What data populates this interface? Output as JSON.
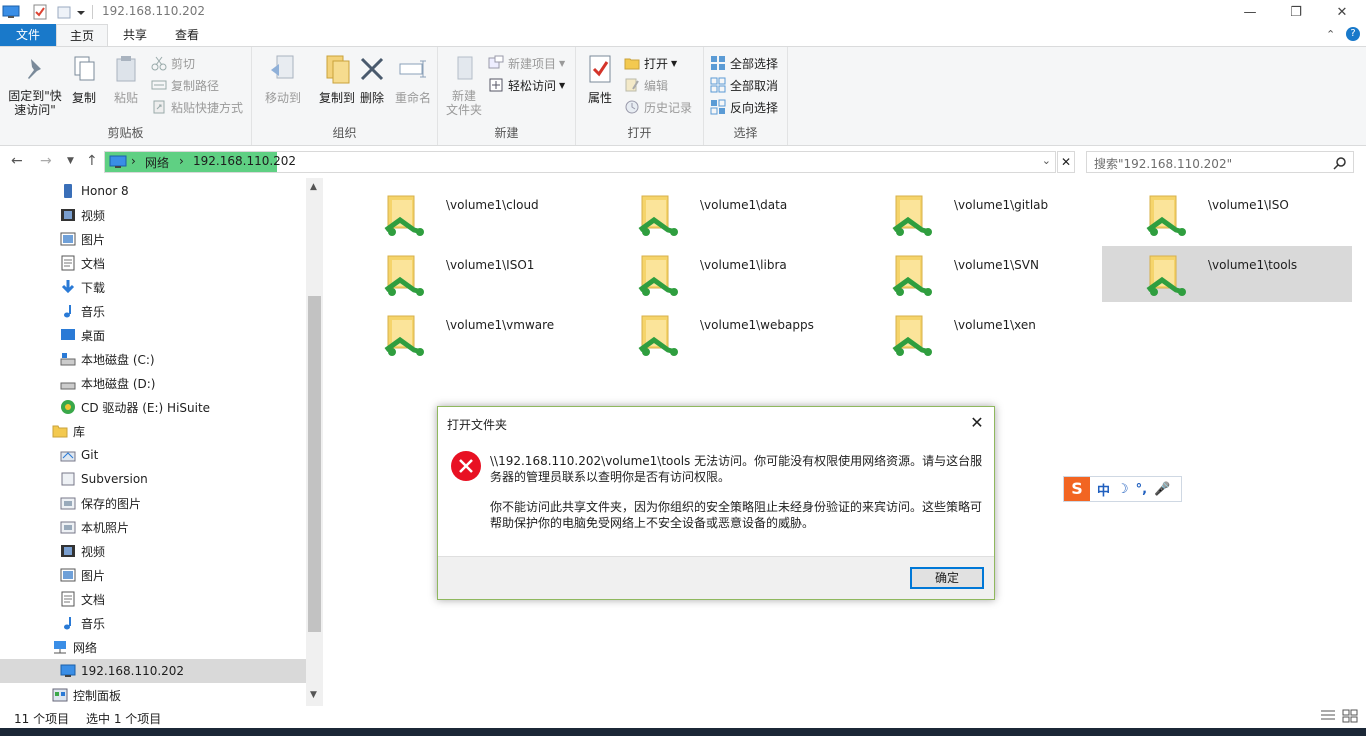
{
  "window": {
    "title": "192.168.110.202"
  },
  "ribbon_tabs": [
    "文件",
    "主页",
    "共享",
    "查看"
  ],
  "ribbon": {
    "clipboard": {
      "label": "剪贴板",
      "pin": "固定到\"快速访问\"",
      "copy": "复制",
      "paste": "粘贴",
      "cut": "剪切",
      "copy_path": "复制路径",
      "paste_shortcut": "粘贴快捷方式"
    },
    "organize": {
      "label": "组织",
      "move_to": "移动到",
      "copy_to": "复制到",
      "delete": "删除",
      "rename": "重命名"
    },
    "new": {
      "label": "新建",
      "new_folder": "新建\n文件夹",
      "new_item": "新建项目",
      "easy_access": "轻松访问"
    },
    "open": {
      "label": "打开",
      "properties": "属性",
      "open": "打开",
      "edit": "编辑",
      "history": "历史记录"
    },
    "select": {
      "label": "选择",
      "select_all": "全部选择",
      "select_none": "全部取消",
      "invert": "反向选择"
    }
  },
  "address": {
    "crumbs": [
      "网络",
      "192.168.110.202"
    ]
  },
  "search": {
    "placeholder": "搜索\"192.168.110.202\""
  },
  "sidebar": {
    "items": [
      "Honor 8",
      "视频",
      "图片",
      "文档",
      "下载",
      "音乐",
      "桌面",
      "本地磁盘 (C:)",
      "本地磁盘 (D:)",
      "CD 驱动器 (E:) HiSuite",
      "库",
      "Git",
      "Subversion",
      "保存的图片",
      "本机照片",
      "视频",
      "图片",
      "文档",
      "音乐",
      "网络",
      "192.168.110.202",
      "控制面板"
    ]
  },
  "folders": [
    "\\volume1\\cloud",
    "\\volume1\\data",
    "\\volume1\\gitlab",
    "\\volume1\\ISO",
    "\\volume1\\ISO1",
    "\\volume1\\libra",
    "\\volume1\\SVN",
    "\\volume1\\tools",
    "\\volume1\\vmware",
    "\\volume1\\webapps",
    "\\volume1\\xen"
  ],
  "status": {
    "count": "11 个项目",
    "selected": "选中 1 个项目"
  },
  "dialog": {
    "title": "打开文件夹",
    "message1": "\\\\192.168.110.202\\volume1\\tools 无法访问。你可能没有权限使用网络资源。请与这台服务器的管理员联系以查明你是否有访问权限。",
    "message2": "你不能访问此共享文件夹，因为你组织的安全策略阻止未经身份验证的来宾访问。这些策略可帮助保护你的电脑免受网络上不安全设备或恶意设备的威胁。",
    "ok": "确定"
  },
  "ime": {
    "logo": "S",
    "mode": "中"
  },
  "colors": {
    "accent": "#1979ca",
    "crumb_highlight": "#5fd083",
    "error": "#e81123",
    "selection": "#d9d9d9"
  }
}
